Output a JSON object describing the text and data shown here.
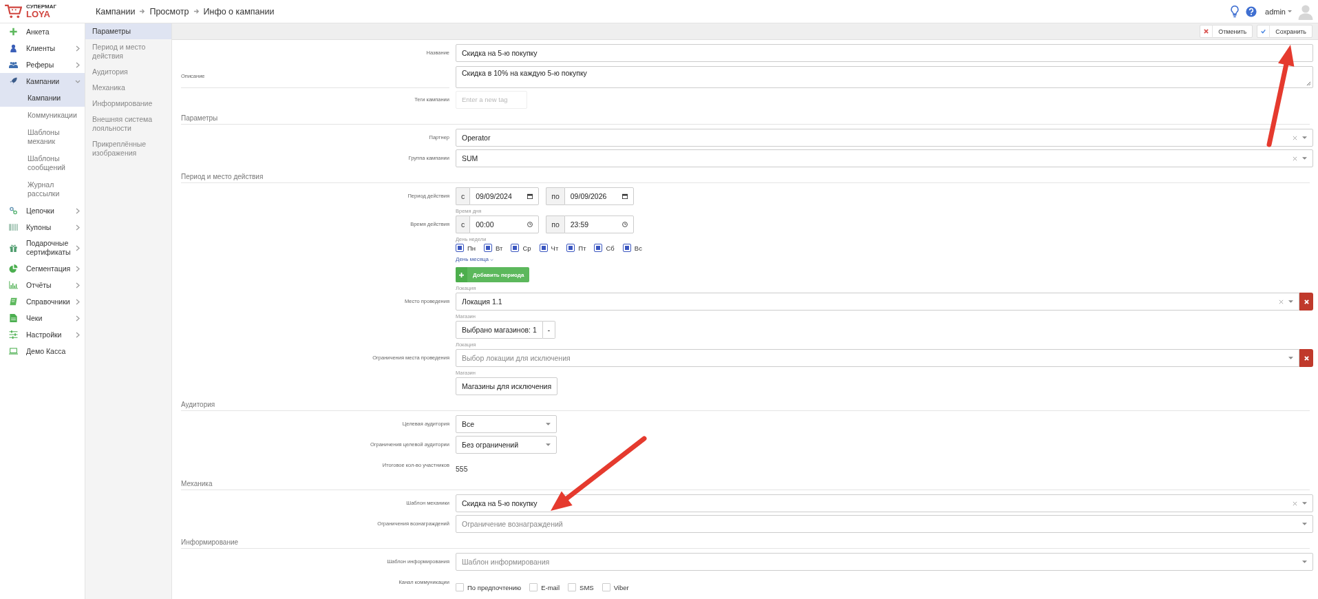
{
  "logo": {
    "line1": "СУПЕРМАГ",
    "line2": "LOYA"
  },
  "breadcrumbs": [
    "Кампании",
    "Просмотр",
    "Инфо о кампании"
  ],
  "user": {
    "name": "admin"
  },
  "sidebar": {
    "items": [
      {
        "label": "Анкета",
        "kind": "link",
        "selected": false
      },
      {
        "label": "Клиенты",
        "kind": "group",
        "expanded": false,
        "selected": false
      },
      {
        "label": "Реферы",
        "kind": "group",
        "expanded": false,
        "selected": false
      },
      {
        "label": "Кампании",
        "kind": "group",
        "expanded": true,
        "selected": true,
        "children": [
          {
            "label": "Кампании",
            "selected": true
          },
          {
            "label": "Коммуникации",
            "selected": false
          },
          {
            "label": "Шаблоны механик",
            "selected": false
          },
          {
            "label": "Шаблоны сообщений",
            "selected": false
          },
          {
            "label": "Журнал рассылки",
            "selected": false
          }
        ]
      },
      {
        "label": "Цепочки",
        "kind": "group",
        "expanded": false,
        "selected": false
      },
      {
        "label": "Купоны",
        "kind": "group",
        "expanded": false,
        "selected": false
      },
      {
        "label": "Подарочные сертификаты",
        "kind": "group",
        "expanded": false,
        "selected": false
      },
      {
        "label": "Сегментация",
        "kind": "group",
        "expanded": false,
        "selected": false
      },
      {
        "label": "Отчёты",
        "kind": "group",
        "expanded": false,
        "selected": false
      },
      {
        "label": "Справочники",
        "kind": "group",
        "expanded": false,
        "selected": false
      },
      {
        "label": "Чеки",
        "kind": "group",
        "expanded": false,
        "selected": false
      },
      {
        "label": "Настройки",
        "kind": "group",
        "expanded": false,
        "selected": false
      },
      {
        "label": "Демо Касса",
        "kind": "link",
        "selected": false
      }
    ]
  },
  "subnav": [
    {
      "label": "Параметры",
      "selected": true
    },
    {
      "label": "Период и место действия",
      "selected": false
    },
    {
      "label": "Аудитория",
      "selected": false
    },
    {
      "label": "Механика",
      "selected": false
    },
    {
      "label": "Информирование",
      "selected": false
    },
    {
      "label": "Внешняя система лояльности",
      "selected": false
    },
    {
      "label": "Прикреплённые изображения",
      "selected": false
    }
  ],
  "toolbar": [
    {
      "label": "Отменить",
      "kind": "cancel"
    },
    {
      "label": "Сохранить",
      "kind": "save"
    }
  ],
  "form": {
    "top_rows": [
      {
        "label": "Название",
        "kind": "text",
        "value": "Скидка на 5-ю покупку"
      },
      {
        "label": "Описание",
        "kind": "textarea",
        "value": "Скидка в 10% на каждую 5-ю покупку"
      },
      {
        "label": "Теги кампании",
        "kind": "tags",
        "placeholder": "Enter a new tag"
      }
    ],
    "sections": [
      {
        "title": "Параметры",
        "rows": [
          {
            "label": "Партнер",
            "kind": "select",
            "value": "Operator",
            "clearable": true
          },
          {
            "label": "Группа кампании",
            "kind": "select",
            "value": "SUM",
            "clearable": true
          }
        ]
      },
      {
        "title": "Период и место действия",
        "rows": [
          {
            "label": "Период действия",
            "kind": "date_range",
            "from_prefix": "с",
            "from": "09/09/2024",
            "to_prefix": "по",
            "to": "09/09/2026"
          },
          {
            "label": "Время действия",
            "kind": "time_range",
            "caption": "Время дня",
            "from_prefix": "с",
            "from": "00:00",
            "to_prefix": "по",
            "to": "23:59"
          },
          {
            "kind": "weekdays",
            "caption": "День недели",
            "days": [
              {
                "label": "Пн",
                "checked": true
              },
              {
                "label": "Вт",
                "checked": true
              },
              {
                "label": "Ср",
                "checked": true
              },
              {
                "label": "Чт",
                "checked": true
              },
              {
                "label": "Пт",
                "checked": true
              },
              {
                "label": "Сб",
                "checked": true
              },
              {
                "label": "Вс",
                "checked": true
              }
            ]
          },
          {
            "kind": "link",
            "text": "День месяца"
          },
          {
            "kind": "add_button",
            "text": "Добавить периода"
          },
          {
            "label": "Место проведения",
            "kind": "location",
            "caption": "Локация",
            "value": "Локация 1.1",
            "clearable": true
          },
          {
            "kind": "store_picker",
            "caption": "Магазин",
            "value": "Выбрано магазинов: 1",
            "toggle": "-"
          },
          {
            "label": "Ограничения места проведения",
            "kind": "location",
            "caption": "Локация",
            "placeholder": "Выбор локации для исключения",
            "clearable": false
          },
          {
            "kind": "button",
            "caption": "Магазин",
            "text": "Магазины для исключения"
          }
        ]
      },
      {
        "title": "Аудитория",
        "rows": [
          {
            "label": "Целевая аудитория",
            "kind": "small_select",
            "value": "Все"
          },
          {
            "label": "Ограничения целевой аудитории",
            "kind": "small_select",
            "value": "Без ограничений"
          },
          {
            "label": "Итоговое кол-во участников",
            "kind": "static",
            "value": "555"
          }
        ]
      },
      {
        "title": "Механика",
        "rows": [
          {
            "label": "Шаблон механики",
            "kind": "select",
            "value": "Скидка на 5-ю покупку",
            "clearable": true
          },
          {
            "label": "Ограничения вознаграждений",
            "kind": "select",
            "placeholder": "Ограничение вознаграждений",
            "clearable": false
          }
        ]
      },
      {
        "title": "Информирование",
        "rows": [
          {
            "label": "Шаблон информирования",
            "kind": "select",
            "placeholder": "Шаблон информирования",
            "clearable": false
          },
          {
            "label": "Канал коммуникации",
            "kind": "checks",
            "options": [
              {
                "label": "По предпочтению",
                "checked": false
              },
              {
                "label": "E-mail",
                "checked": false
              },
              {
                "label": "SMS",
                "checked": false
              },
              {
                "label": "Viber",
                "checked": false
              }
            ]
          }
        ]
      }
    ]
  }
}
